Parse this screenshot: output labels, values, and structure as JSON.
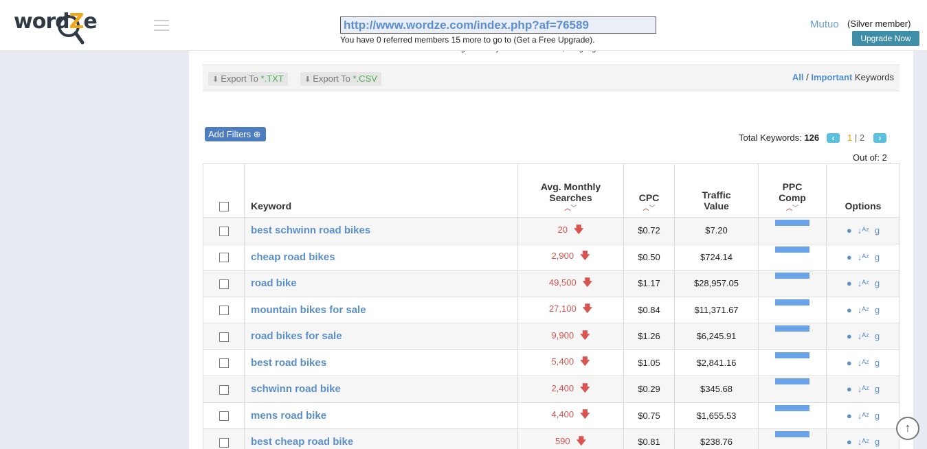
{
  "header": {
    "logo_text_a": "word",
    "logo_text_z": "Z",
    "logo_text_b": "e",
    "ref_url": "http://www.wordze.com/index.php?af=76589",
    "ref_note": "You have 0 referred members 15 more to go to (Get a Free Upgrade).",
    "username": "Mutuo",
    "member_level": "(Silver member)",
    "upgrade_label": "Upgrade Now"
  },
  "clipped_info": "Google Country: UNITED STATES, Language: ENGLISH",
  "export": {
    "txt_prefix": "Export To ",
    "txt_ext": "*.TXT",
    "csv_prefix": "Export To ",
    "csv_ext": "*.CSV"
  },
  "keyword_filter": {
    "all": "All",
    "sep": " / ",
    "important": "Important",
    "suffix": " Keywords"
  },
  "filters": {
    "add_label": "Add Filters"
  },
  "pagination": {
    "total_label": "Total Keywords: ",
    "total": "126",
    "page_current": "1",
    "page_sep": " | ",
    "page_next": "2",
    "out_of": "Out of: 2"
  },
  "table": {
    "headers": {
      "keyword": "Keyword",
      "avg1": "Avg. Monthly",
      "avg2": "Searches",
      "cpc": "CPC",
      "traffic1": "Traffic",
      "traffic2": "Value",
      "ppc1": "PPC",
      "ppc2": "Comp",
      "options": "Options"
    },
    "rows": [
      {
        "keyword": "best schwinn road bikes",
        "searches": "20",
        "cpc": "$0.72",
        "traffic": "$7.20"
      },
      {
        "keyword": "cheap road bikes",
        "searches": "2,900",
        "cpc": "$0.50",
        "traffic": "$724.14"
      },
      {
        "keyword": "road bike",
        "searches": "49,500",
        "cpc": "$1.17",
        "traffic": "$28,957.05"
      },
      {
        "keyword": "mountain bikes for sale",
        "searches": "27,100",
        "cpc": "$0.84",
        "traffic": "$11,371.67"
      },
      {
        "keyword": "road bikes for sale",
        "searches": "9,900",
        "cpc": "$1.26",
        "traffic": "$6,245.91"
      },
      {
        "keyword": "best road bikes",
        "searches": "5,400",
        "cpc": "$1.05",
        "traffic": "$2,841.16"
      },
      {
        "keyword": "schwinn road bike",
        "searches": "2,400",
        "cpc": "$0.29",
        "traffic": "$345.68"
      },
      {
        "keyword": "mens road bike",
        "searches": "4,400",
        "cpc": "$0.75",
        "traffic": "$1,655.53"
      },
      {
        "keyword": "best cheap road bike",
        "searches": "590",
        "cpc": "$0.81",
        "traffic": "$238.76"
      }
    ]
  },
  "icons": {
    "menu": "hamburger-icon",
    "download": "download-icon",
    "plus": "plus-circle-icon",
    "prev": "chevron-left-icon",
    "next": "chevron-right-icon",
    "trend": "arrow-down-icon",
    "globe": "globe-icon",
    "sort_az": "sort-alpha-icon",
    "google": "google-icon",
    "scroll_top": "arrow-up-circle-icon"
  },
  "colors": {
    "link": "#5b8fc9",
    "accent": "#f2a81d",
    "down": "#d9534f",
    "upgrade": "#3f8ea8",
    "ppc_bar": "#6aa3e8"
  }
}
